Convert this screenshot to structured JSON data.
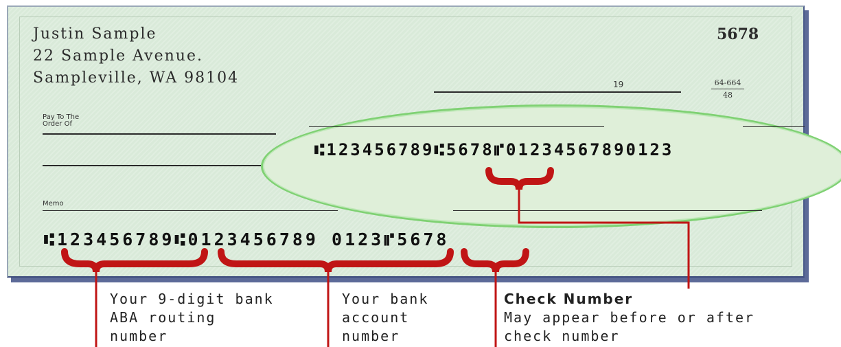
{
  "check": {
    "name": "Justin Sample",
    "address_line1": "22 Sample Avenue.",
    "address_line2": "Sampleville, WA 98104",
    "check_number": "5678",
    "date_suffix": "19",
    "fraction_top": "64-664",
    "fraction_bottom": "48",
    "pay_to_line1": "Pay To The",
    "pay_to_line2": "Order Of",
    "memo_label": "Memo",
    "micr_line": "⑆123456789⑆0123456789 0123⑈5678",
    "micr_zoom": "⑆123456789⑆5678⑈01234567890123"
  },
  "labels": {
    "routing": [
      "Your 9-digit bank",
      "ABA routing",
      "number"
    ],
    "account": [
      "Your bank",
      "account",
      "number"
    ],
    "check_number_title": "Check Number",
    "check_number_desc": [
      "May appear before or after",
      "check number"
    ]
  },
  "colors": {
    "check_background": "#d9ead9",
    "callout": "#c01515",
    "magnifier_outline": "#7fd173"
  }
}
